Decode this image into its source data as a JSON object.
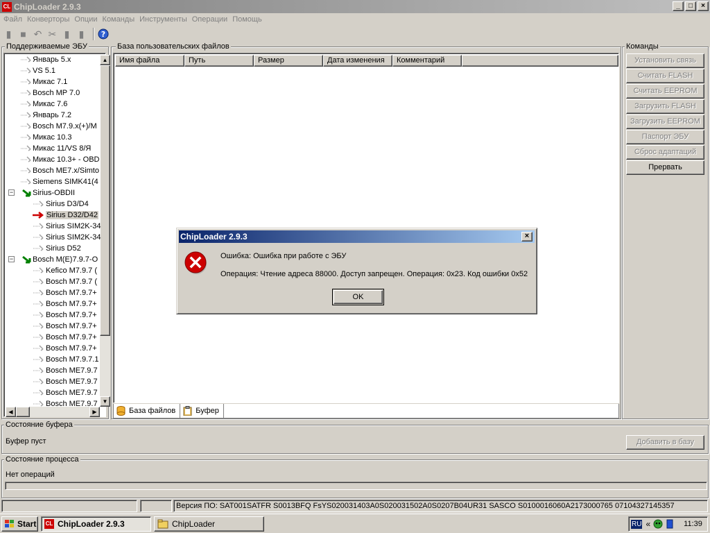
{
  "window": {
    "title": "ChipLoader 2.9.3",
    "icon_label": "CL"
  },
  "menu": [
    "Файл",
    "Конверторы",
    "Опции",
    "Команды",
    "Инструменты",
    "Операции",
    "Помощь"
  ],
  "panels": {
    "ecu_list": "Поддерживаемые ЭБУ",
    "file_db": "База пользовательских файлов",
    "commands": "Команды",
    "buffer_state": "Состояние буфера",
    "process_state": "Состояние процесса"
  },
  "tree": [
    {
      "label": "Январь 5.x",
      "level": 1
    },
    {
      "label": "VS 5.1",
      "level": 1
    },
    {
      "label": "Микас 7.1",
      "level": 1
    },
    {
      "label": "Bosch MP 7.0",
      "level": 1
    },
    {
      "label": "Микас 7.6",
      "level": 1
    },
    {
      "label": "Январь 7.2",
      "level": 1
    },
    {
      "label": "Bosch M7.9.x(+)/M",
      "level": 1
    },
    {
      "label": "Микас 10.3",
      "level": 1
    },
    {
      "label": "Микас 11/VS 8/Я",
      "level": 1
    },
    {
      "label": "Микас 10.3+ - OBD",
      "level": 1
    },
    {
      "label": "Bosch ME7.x/Simto",
      "level": 1
    },
    {
      "label": "Siemens SIMK41(4",
      "level": 1
    },
    {
      "label": "Sirius-OBDII",
      "level": 0
    },
    {
      "label": "Sirius D3/D4",
      "level": 2
    },
    {
      "label": "Sirius D32/D42",
      "level": 2
    },
    {
      "label": "Sirius SIM2K-34",
      "level": 2
    },
    {
      "label": "Sirius SIM2K-34",
      "level": 2
    },
    {
      "label": "Sirius D52",
      "level": 2
    },
    {
      "label": "Bosch M(E)7.9.7-O",
      "level": 0
    },
    {
      "label": "Kefico M7.9.7 (",
      "level": 2
    },
    {
      "label": "Bosch M7.9.7 (",
      "level": 2
    },
    {
      "label": "Bosch M7.9.7+",
      "level": 2
    },
    {
      "label": "Bosch M7.9.7+",
      "level": 2
    },
    {
      "label": "Bosch M7.9.7+",
      "level": 2
    },
    {
      "label": "Bosch M7.9.7+",
      "level": 2
    },
    {
      "label": "Bosch M7.9.7+",
      "level": 2
    },
    {
      "label": "Bosch M7.9.7+",
      "level": 2
    },
    {
      "label": "Bosch M7.9.7.1",
      "level": 2
    },
    {
      "label": "Bosch ME7.9.7",
      "level": 2
    },
    {
      "label": "Bosch ME7.9.7",
      "level": 2
    },
    {
      "label": "Bosch ME7.9.7",
      "level": 2
    },
    {
      "label": "Bosch ME7.9.7",
      "level": 2
    }
  ],
  "columns": [
    "Имя файла",
    "Путь",
    "Размер",
    "Дата изменения",
    "Комментарий"
  ],
  "tabs": [
    "База файлов",
    "Буфер"
  ],
  "commands": [
    {
      "label": "Установить связь",
      "enabled": false
    },
    {
      "label": "Считать FLASH",
      "enabled": false
    },
    {
      "label": "Считать EEPROM",
      "enabled": false
    },
    {
      "label": "Загрузить FLASH",
      "enabled": false
    },
    {
      "label": "Загрузить EEPROM",
      "enabled": false
    },
    {
      "label": "Паспорт ЭБУ",
      "enabled": false
    },
    {
      "label": "Сброс адаптаций",
      "enabled": false
    },
    {
      "label": "Прервать",
      "enabled": true
    }
  ],
  "buffer": {
    "status": "Буфер пуст",
    "add_button": "Добавить в базу"
  },
  "process": {
    "status": "Нет операций"
  },
  "statusbar": {
    "version": "Версия ПО:  SAT001SATFR S0013BFQ FsYS020031403A0S020031502A0S0207B04UR31 SASCO S0100016060A2173000765 07104327145357"
  },
  "dialog": {
    "title": "ChipLoader 2.9.3",
    "line1": "Ошибка: Ошибка при работе с ЭБУ",
    "line2": "Операция: Чтение адреса 88000. Доступ запрещен. Операция: 0x23. Код ошибки 0x52",
    "ok": "OK"
  },
  "taskbar": {
    "start": "Start",
    "tasks": [
      "ChipLoader 2.9.3",
      "ChipLoader"
    ],
    "lang": "RU",
    "clock": "11:39"
  },
  "colors": {
    "dialog_title": "#0a246a",
    "error_icon": "#cc0000",
    "selected_arrow": "#cc0000"
  }
}
